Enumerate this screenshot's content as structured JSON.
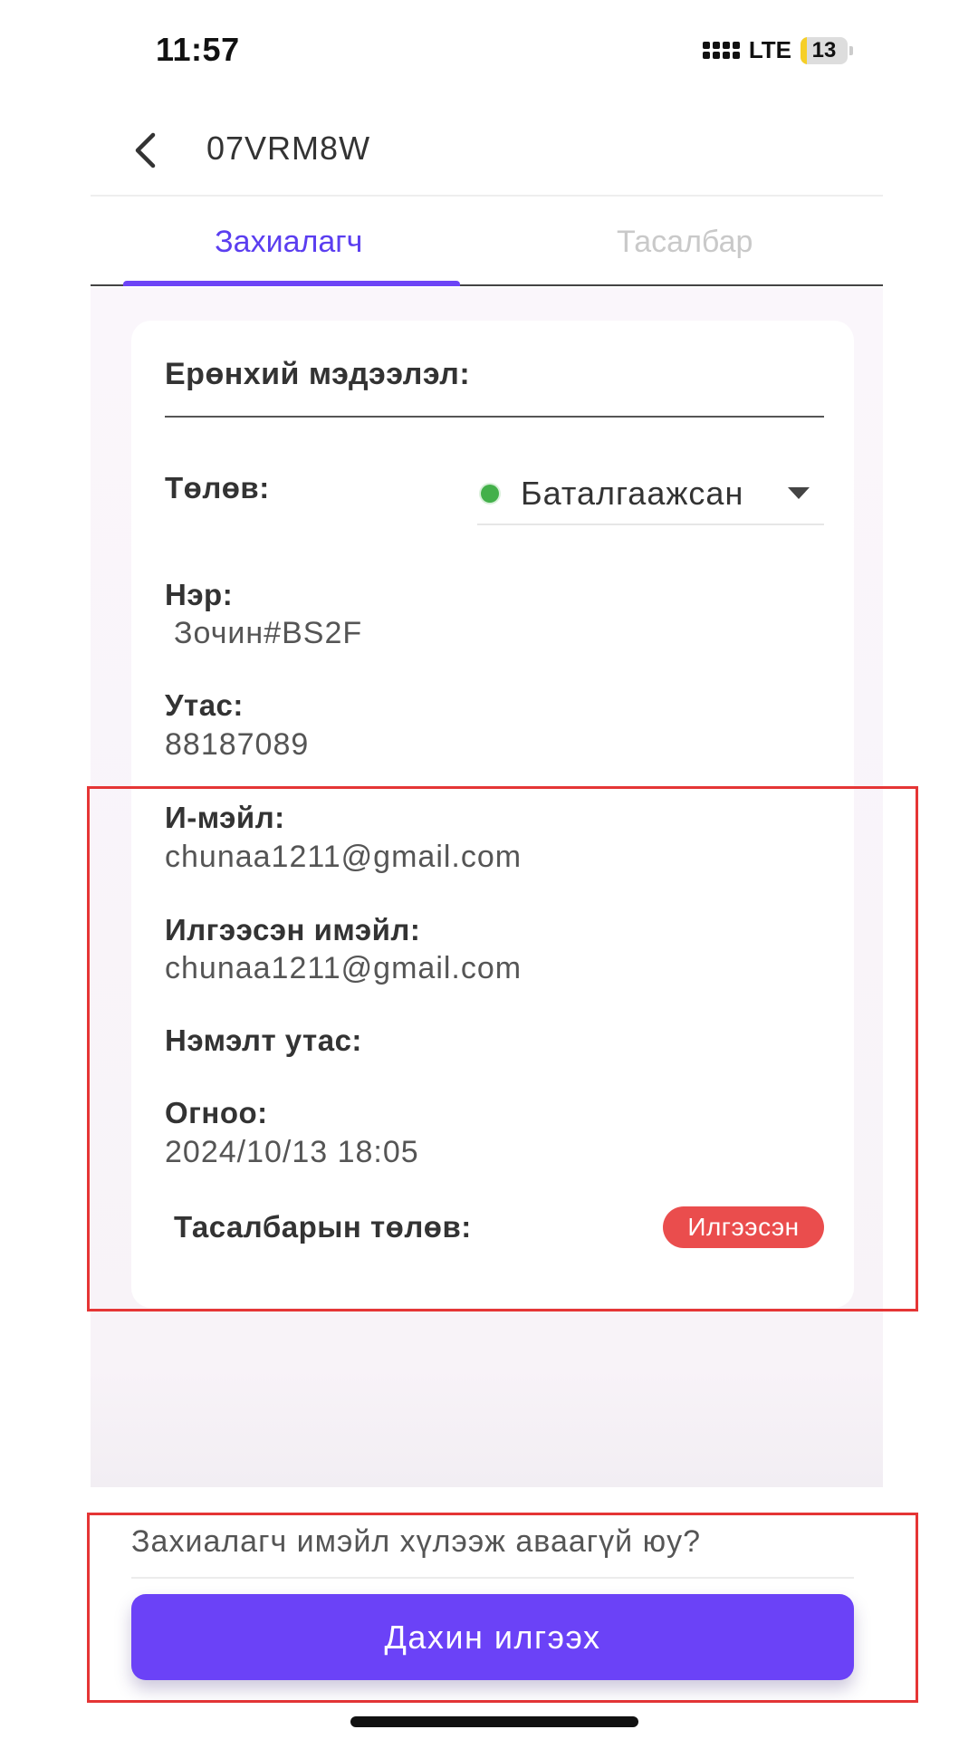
{
  "status_bar": {
    "time": "11:57",
    "network": "LTE",
    "battery_level": "13",
    "battery_fraction": 0.13
  },
  "header": {
    "back_icon": "chevron-left-icon",
    "title": "07VRM8W"
  },
  "tabs": [
    {
      "label": "Захиалагч",
      "active": true
    },
    {
      "label": "Тасалбар",
      "active": false
    }
  ],
  "general_info": {
    "title": "Ерөнхий мэдээлэл:",
    "status": {
      "label": "Төлөв:",
      "value": "Баталгаажсан",
      "dot_color": "#43b04a"
    },
    "name": {
      "label": "Нэр:",
      "value": "Зочин#BS2F"
    },
    "phone": {
      "label": "Утас:",
      "value": "88187089"
    },
    "email": {
      "label": "И-мэйл:",
      "value": "chunaa1211@gmail.com"
    },
    "sent_email": {
      "label": "Илгээсэн имэйл:",
      "value": "chunaa1211@gmail.com"
    },
    "extra_phone": {
      "label": "Нэмэлт утас:",
      "value": ""
    },
    "date": {
      "label": "Огноо:",
      "value": "2024/10/13 18:05"
    },
    "ticket_status": {
      "label": "Тасалбарын төлөв:",
      "value": "Илгээсэн",
      "color": "#ea4d4d"
    }
  },
  "footer": {
    "prompt": "Захиалагч имэйл хүлээж аваагүй юу?",
    "resend_button": "Дахин илгээх"
  },
  "colors": {
    "accent": "#6b42f7",
    "highlight_box": "#e53535"
  }
}
